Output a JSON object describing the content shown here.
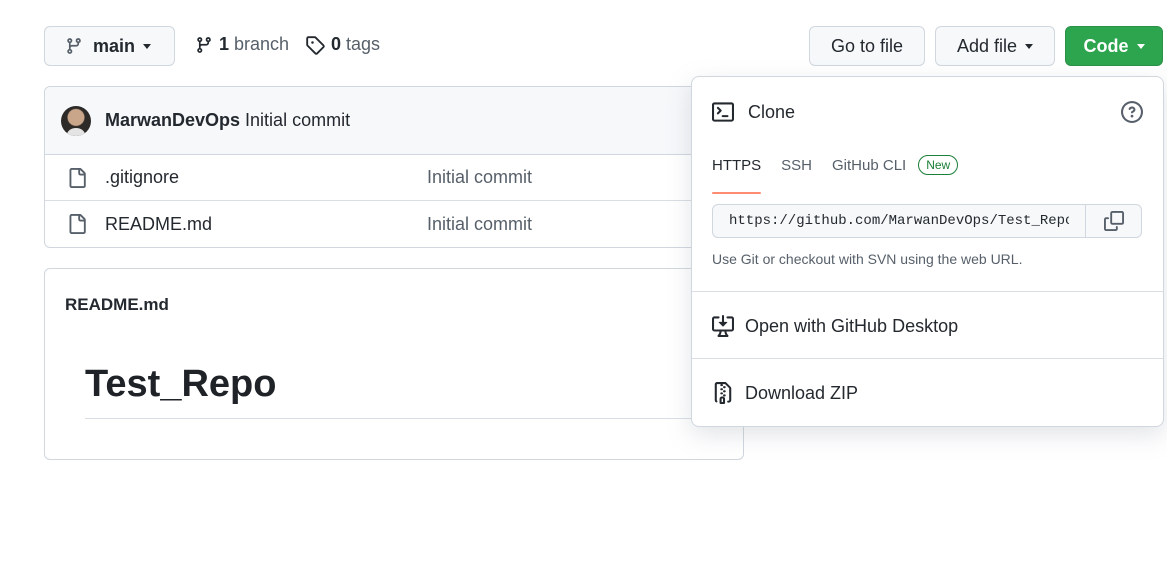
{
  "toolbar": {
    "branch_name": "main",
    "branch_count": "1",
    "branch_label": "branch",
    "tag_count": "0",
    "tag_label": "tags",
    "go_to_file": "Go to file",
    "add_file": "Add file",
    "code": "Code",
    "code_color": "#2da44e"
  },
  "commit": {
    "author": "MarwanDevOps",
    "message": "Initial commit"
  },
  "files": [
    {
      "name": ".gitignore",
      "commit": "Initial commit",
      "icon": "file-icon"
    },
    {
      "name": "README.md",
      "commit": "Initial commit",
      "icon": "file-icon"
    }
  ],
  "readme": {
    "filename": "README.md",
    "heading": "Test_Repo"
  },
  "clone_panel": {
    "title": "Clone",
    "tabs": [
      "HTTPS",
      "SSH",
      "GitHub CLI"
    ],
    "active_tab": "HTTPS",
    "new_badge": "New",
    "url": "https://github.com/MarwanDevOps/Test_Repo.git",
    "hint": "Use Git or checkout with SVN using the web URL.",
    "open_desktop": "Open with GitHub Desktop",
    "download_zip": "Download ZIP",
    "accent_color": "#fd8c73"
  }
}
